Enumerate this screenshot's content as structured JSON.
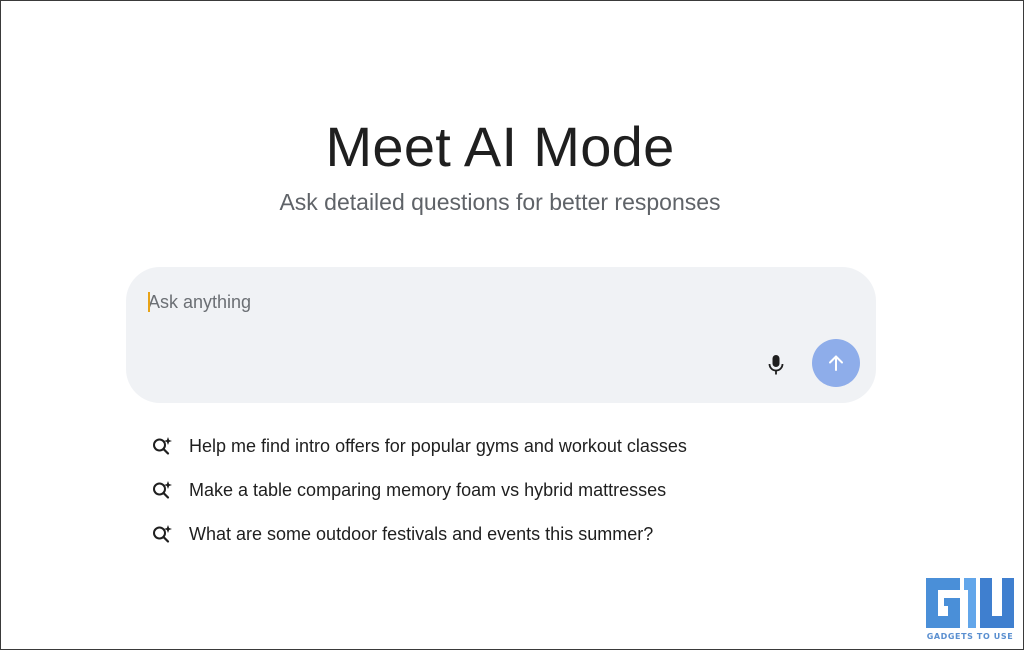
{
  "hero": {
    "title": "Meet AI Mode",
    "subtitle": "Ask detailed questions for better responses"
  },
  "prompt": {
    "placeholder": "Ask anything",
    "value": "",
    "mic_icon": "microphone-icon",
    "send_icon": "arrow-up-icon",
    "send_button_color": "#8eadea"
  },
  "suggestions": [
    {
      "icon": "sparkle-search-icon",
      "label": "Help me find intro offers for popular gyms and workout classes"
    },
    {
      "icon": "sparkle-search-icon",
      "label": "Make a table comparing memory foam vs hybrid mattresses"
    },
    {
      "icon": "sparkle-search-icon",
      "label": "What are some outdoor festivals and events this summer?"
    }
  ],
  "watermark": {
    "text": "GADGETS TO USE",
    "accent": "#4a8fd8"
  }
}
